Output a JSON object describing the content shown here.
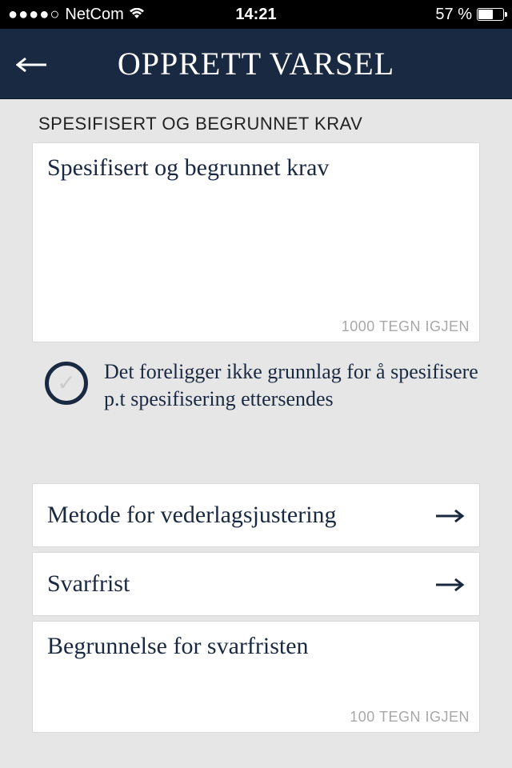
{
  "status_bar": {
    "signal_dots": "●●●●○",
    "carrier": "NetCom",
    "time": "14:21",
    "battery_percent": "57 %"
  },
  "nav": {
    "title": "OPPRETT VARSEL"
  },
  "section_label": "SPESIFISERT OG BEGRUNNET KRAV",
  "textarea1": {
    "placeholder": "Spesifisert og begrunnet krav",
    "counter": "1000 TEGN IGJEN"
  },
  "checkbox": {
    "text": "Det foreligger ikke grunnlag for å spesifisere p.t  spesifisering ettersendes"
  },
  "rows": {
    "method": "Metode for vederlagsjustering",
    "deadline": "Svarfrist"
  },
  "textarea2": {
    "placeholder": "Begrunnelse for svarfristen",
    "counter": "100 TEGN IGJEN"
  }
}
